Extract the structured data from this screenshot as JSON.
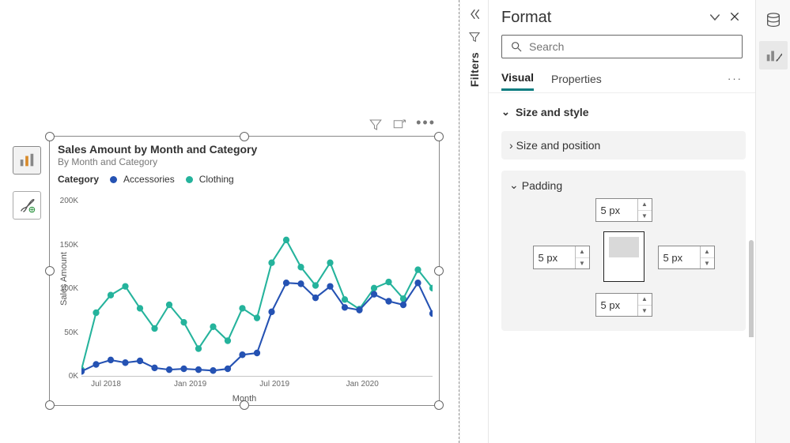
{
  "canvas": {
    "buttons": {
      "visual_switch_label": "visual-switch",
      "paint_label": "paint"
    },
    "visual_toolbar": {
      "filter_label": "Filter",
      "focus_label": "Focus",
      "more_label": "More"
    }
  },
  "filters_pane": {
    "label": "Filters"
  },
  "format_pane": {
    "title": "Format",
    "search_placeholder": "Search",
    "tabs": {
      "visual": "Visual",
      "properties": "Properties"
    },
    "sections": {
      "size_style": "Size and style",
      "size_position": "Size and position",
      "padding": "Padding"
    },
    "padding": {
      "top": "5 px",
      "right": "5 px",
      "bottom": "5 px",
      "left": "5 px"
    }
  },
  "chart": {
    "title": "Sales Amount by Month and Category",
    "subtitle": "By Month and Category",
    "legend_title": "Category",
    "series_names": [
      "Accessories",
      "Clothing"
    ],
    "xlabel": "Month",
    "ylabel": "Sales Amount",
    "y_ticks": [
      "0K",
      "50K",
      "100K",
      "150K",
      "200K"
    ],
    "x_ticks": [
      "Jul 2018",
      "Jan 2019",
      "Jul 2019",
      "Jan 2020"
    ],
    "colors": {
      "accessories": "#2552b3",
      "clothing": "#25b39c"
    }
  },
  "chart_data": {
    "type": "line",
    "title": "Sales Amount by Month and Category",
    "subtitle": "By Month and Category",
    "xlabel": "Month",
    "ylabel": "Sales Amount",
    "ylim": [
      0,
      200000
    ],
    "x": [
      "2018-06",
      "2018-07",
      "2018-08",
      "2018-09",
      "2018-10",
      "2018-11",
      "2018-12",
      "2019-01",
      "2019-02",
      "2019-03",
      "2019-04",
      "2019-05",
      "2019-06",
      "2019-07",
      "2019-08",
      "2019-09",
      "2019-10",
      "2019-11",
      "2019-12",
      "2020-01",
      "2020-02",
      "2020-03",
      "2020-04",
      "2020-05",
      "2020-06"
    ],
    "series": [
      {
        "name": "Accessories",
        "color": "#2552b3",
        "values": [
          6000,
          14000,
          19000,
          16000,
          18000,
          10000,
          8000,
          9000,
          8000,
          7000,
          9000,
          25000,
          27000,
          74000,
          107000,
          106000,
          90000,
          103000,
          79000,
          76000,
          94000,
          86000,
          82000,
          107000,
          72000
        ]
      },
      {
        "name": "Clothing",
        "color": "#25b39c",
        "values": [
          8000,
          73000,
          93000,
          103000,
          78000,
          55000,
          82000,
          62000,
          32000,
          57000,
          41000,
          78000,
          67000,
          130000,
          156000,
          125000,
          104000,
          130000,
          88000,
          77000,
          101000,
          108000,
          89000,
          122000,
          101000
        ]
      }
    ],
    "legend_position": "top"
  }
}
